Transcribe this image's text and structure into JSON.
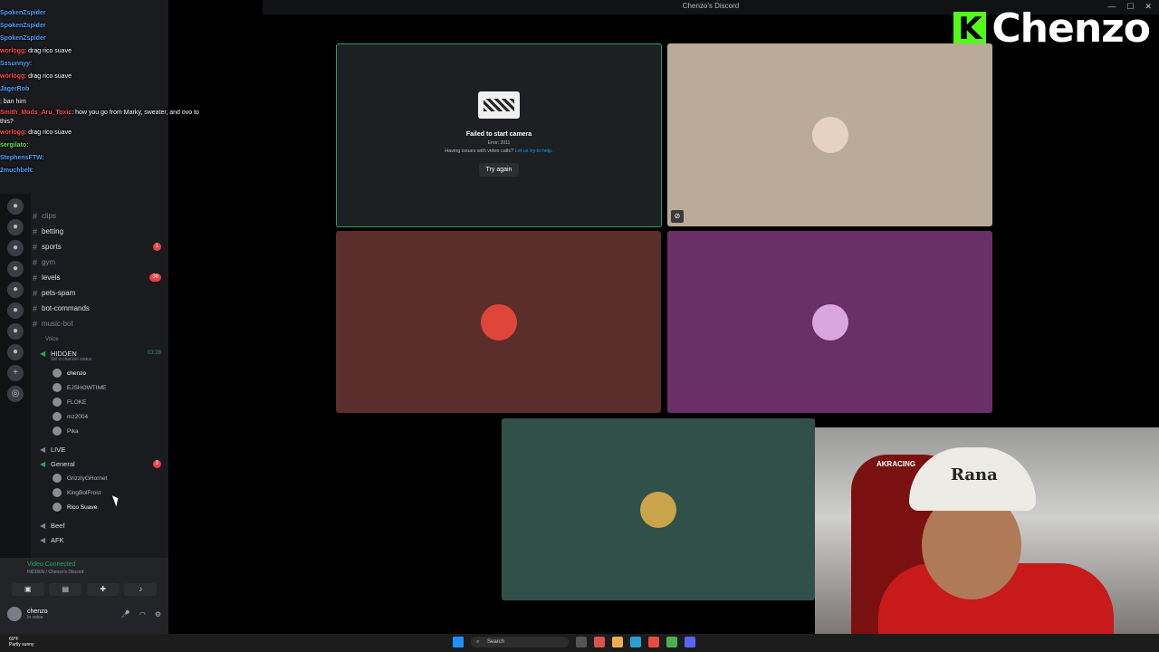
{
  "window": {
    "title": "Chenzo's Discord"
  },
  "brand": {
    "logo_letter": "K",
    "name": "Chenzo",
    "logo_color": "#53fc18"
  },
  "chat": [
    {
      "user": "SpokenZspider",
      "text": ""
    },
    {
      "user": "SpokenZspider",
      "text": ""
    },
    {
      "user": "SpokenZspider",
      "text": ""
    },
    {
      "user": "worlogg",
      "text": ": drag rico suave"
    },
    {
      "user": "Sssunnyy",
      "text": ":"
    },
    {
      "user": "worlogg",
      "text": ": drag rico suave"
    },
    {
      "user": "JagerRob",
      "text": ""
    },
    {
      "user": "",
      "text": ": ban him"
    },
    {
      "user": "Smith_Mods_Aru_Toxic",
      "text": ": how you go from Marky, sweater, and ovo to"
    },
    {
      "user": "",
      "text": "this?"
    },
    {
      "user": "worlogg",
      "text": ": drag rico suave"
    },
    {
      "user": "sergilato",
      "text": ":"
    },
    {
      "user": "StephensFTW",
      "text": ":"
    },
    {
      "user": "2muchbelt",
      "text": ":"
    }
  ],
  "channels": {
    "text": [
      {
        "name": "clips",
        "badge": "",
        "dim": true
      },
      {
        "name": "betting",
        "badge": "",
        "dim": false
      },
      {
        "name": "sports",
        "badge": "1",
        "dim": false
      },
      {
        "name": "gym",
        "badge": "",
        "dim": true
      },
      {
        "name": "levels",
        "badge": "36",
        "dim": false
      },
      {
        "name": "pets-spam",
        "badge": "",
        "dim": false
      },
      {
        "name": "bot-commands",
        "badge": "",
        "dim": false
      },
      {
        "name": "music-bot",
        "badge": "",
        "dim": true
      }
    ],
    "voice_header": "Voice",
    "hidden": {
      "name": "HIDDEN",
      "sub": "Set a channel status",
      "time": "03:28"
    },
    "hidden_users": [
      "chenzo",
      "EJSHOWTIME",
      "FLOKE",
      "mz2004",
      "Pika"
    ],
    "live": "LIVE",
    "general": {
      "name": "General",
      "badge": "3"
    },
    "general_users": [
      "GrizzlyGHornet",
      "KingBolFrost",
      "Rico Suave"
    ],
    "beef": "Beef",
    "afk": "AFK"
  },
  "connection": {
    "status": "Video Connected",
    "sub": "HIDDEN / Chenzo's Discord"
  },
  "me": {
    "name": "chenzo",
    "status": "In voice"
  },
  "camera_fail": {
    "title": "Failed to start camera",
    "error": "Error: 2011",
    "help_prefix": "Having issues with video calls?",
    "help_link": "Let us try to help.",
    "retry": "Try again"
  },
  "tiles": [
    {
      "color": "#1e1f22",
      "avatar": "#ccc"
    },
    {
      "color": "#b9ab98",
      "avatar": "#e6d2c0"
    },
    {
      "color": "#5b2e2b",
      "avatar": "#e0453a"
    },
    {
      "color": "#6b2f67",
      "avatar": "#d9a6e0"
    },
    {
      "color": "#32504a",
      "avatar": "#c9a44a"
    }
  ],
  "webcam": {
    "hat_text": "Rana",
    "chair_text": "AKRACING"
  },
  "taskbar": {
    "weather_temp": "69°F",
    "weather_desc": "Partly sunny",
    "search_placeholder": "Search"
  }
}
